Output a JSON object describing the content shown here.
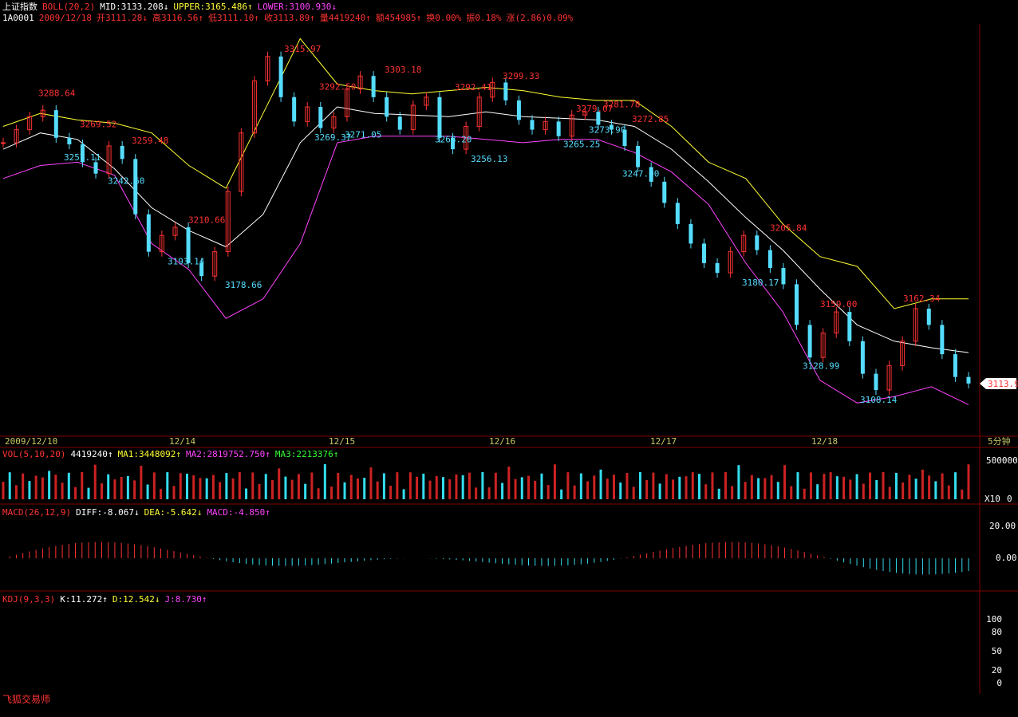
{
  "header": {
    "name": "上证指数",
    "boll_label": "BOLL(20,2)",
    "mid": "MID:3133.208↓",
    "upper": "UPPER:3165.486↑",
    "lower": "LOWER:3100.930↓",
    "code": "1A0001",
    "date": "2009/12/18",
    "open": "开3111.28↓",
    "high": "高3116.56↑",
    "low": "低3111.10↑",
    "close": "收3113.89↑",
    "volume": "量4419240↑",
    "amount": "额454985↑",
    "turnover": "换0.00%",
    "amplitude": "振0.18%",
    "change": "涨(2.86)0.09%"
  },
  "vol_header": {
    "label": "VOL(5,10,20)",
    "value": "4419240↑",
    "ma1": "MA1:3448092↑",
    "ma2": "MA2:2819752.750↑",
    "ma3": "MA3:2213376↑"
  },
  "macd_header": {
    "label": "MACD(26,12,9)",
    "diff": "DIFF:-8.067↓",
    "dea": "DEA:-5.642↓",
    "macd": "MACD:-4.850↑"
  },
  "kdj_header": {
    "label": "KDJ(9,3,3)",
    "k": "K:11.272↑",
    "d": "D:12.542↓",
    "j": "J:8.730↑"
  },
  "price_tag": "3113.9",
  "period": "5分钟",
  "brand": "飞狐交易师",
  "colors": {
    "up": "#ff3333",
    "down": "#55ddff",
    "mid": "#ffffff",
    "upper": "#ffff33",
    "lower": "#ff44ff"
  },
  "chart_data": [
    {
      "type": "line",
      "title": "",
      "ylim": [
        3085,
        3335
      ],
      "x": [
        "2009/12/10",
        "12/14",
        "12/15",
        "12/16",
        "12/17",
        "12/18"
      ],
      "series": [
        {
          "name": "MID",
          "values": [
            3258,
            3268,
            3264,
            3246,
            3222,
            3208,
            3198,
            3218,
            3262,
            3284,
            3280,
            3279,
            3278,
            3281,
            3278,
            3277,
            3276,
            3272,
            3258,
            3238,
            3216,
            3196,
            3172,
            3150,
            3140,
            3136,
            3133
          ]
        },
        {
          "name": "UPPER",
          "values": [
            3272,
            3280,
            3276,
            3274,
            3268,
            3248,
            3234,
            3280,
            3326,
            3298,
            3294,
            3292,
            3294,
            3296,
            3294,
            3290,
            3288,
            3288,
            3272,
            3250,
            3240,
            3212,
            3192,
            3186,
            3160,
            3166,
            3166
          ]
        },
        {
          "name": "LOWER",
          "values": [
            3240,
            3248,
            3250,
            3242,
            3200,
            3184,
            3154,
            3166,
            3200,
            3262,
            3266,
            3266,
            3266,
            3264,
            3262,
            3264,
            3264,
            3256,
            3244,
            3224,
            3188,
            3158,
            3116,
            3102,
            3106,
            3112,
            3101
          ]
        }
      ],
      "candles_close": [
        3262,
        3270,
        3278,
        3282,
        3265,
        3261,
        3250,
        3243,
        3260,
        3252,
        3218,
        3195,
        3205,
        3210,
        3188,
        3180,
        3195,
        3232,
        3268,
        3300,
        3315,
        3290,
        3275,
        3284,
        3271,
        3278,
        3295,
        3303,
        3290,
        3278,
        3270,
        3285,
        3290,
        3265,
        3258,
        3272,
        3290,
        3299,
        3288,
        3276,
        3270,
        3275,
        3266,
        3279,
        3281,
        3273,
        3270,
        3260,
        3247,
        3238,
        3225,
        3212,
        3200,
        3188,
        3182,
        3195,
        3205,
        3196,
        3185,
        3175,
        3150,
        3130,
        3145,
        3158,
        3140,
        3120,
        3110,
        3125,
        3140,
        3160,
        3150,
        3132,
        3118,
        3114
      ],
      "annotations": [
        "3288.64",
        "3269.52",
        "3259.48",
        "3257.11",
        "3242.60",
        "3210.66",
        "3193.14",
        "3178.66",
        "3315.97",
        "3292.50",
        "3269.37",
        "3271.05",
        "3303.18",
        "3292.41",
        "3268.20",
        "3256.13",
        "3299.33",
        "3279.07",
        "3281.78",
        "3273.90",
        "3265.25",
        "3272.85",
        "3247.00",
        "3205.84",
        "3180.17",
        "3159.00",
        "3128.99",
        "3162.34",
        "3108.14"
      ]
    },
    {
      "type": "bar",
      "title": "",
      "yticks": [
        "500000",
        "0"
      ],
      "unit": "X10"
    },
    {
      "type": "line",
      "title": "",
      "yticks": [
        "20.00",
        "0.00"
      ]
    },
    {
      "type": "line",
      "title": "",
      "yticks": [
        "100",
        "80",
        "50",
        "20",
        "0"
      ]
    }
  ]
}
